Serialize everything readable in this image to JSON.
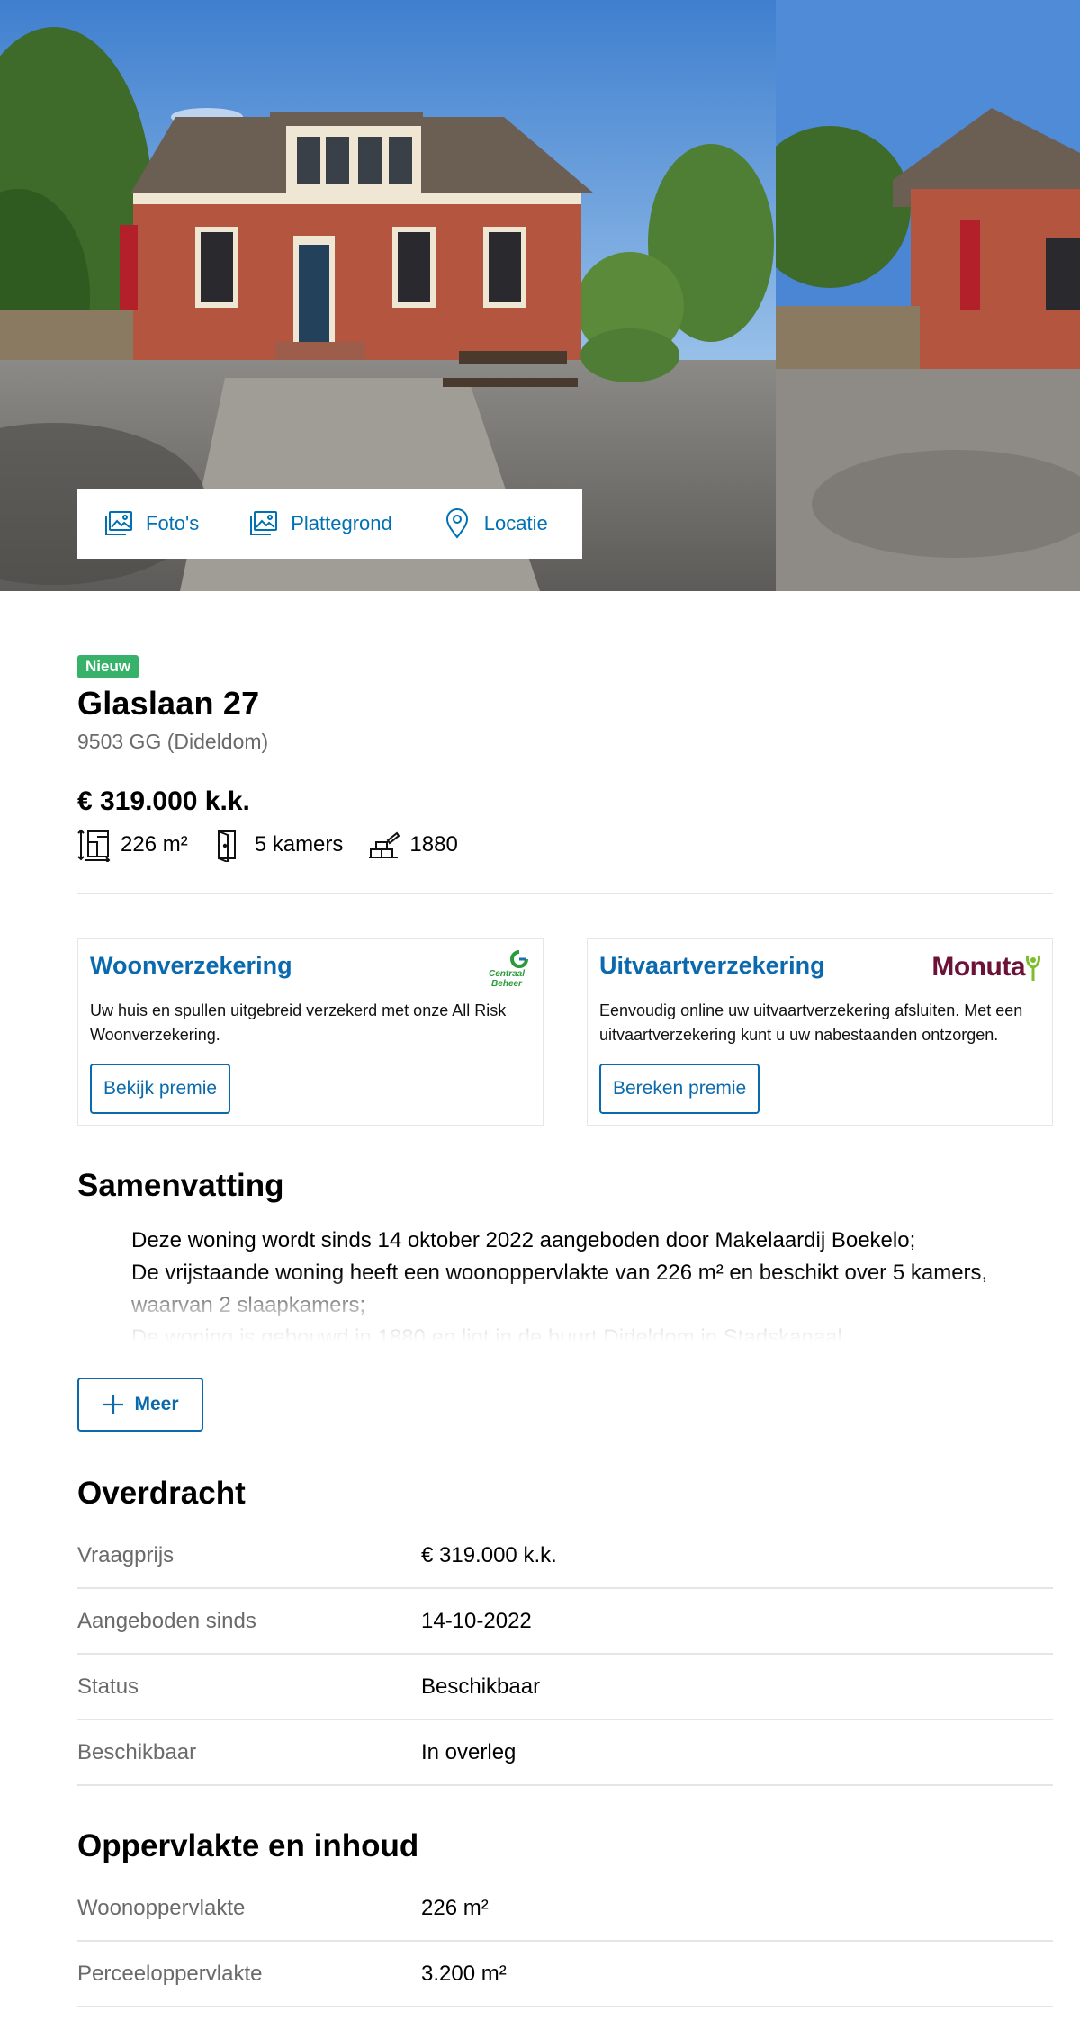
{
  "media": {
    "photos_label": "Foto's",
    "floorplan_label": "Plattegrond",
    "location_label": "Locatie"
  },
  "listing": {
    "badge": "Nieuw",
    "title": "Glaslaan 27",
    "subtitle": "9503 GG (Dideldom)",
    "price": "€ 319.000 k.k.",
    "features": [
      {
        "icon": "floor-area-icon",
        "value": "226 m²"
      },
      {
        "icon": "door-icon",
        "value": "5 kamers"
      },
      {
        "icon": "construction-year-icon",
        "value": "1880"
      }
    ]
  },
  "ads": [
    {
      "title": "Woonverzekering",
      "text": "Uw huis en spullen uitgebreid verzekerd met onze All Risk Woonverzekering.",
      "button": "Bekijk premie",
      "logo": "Centraal Beheer"
    },
    {
      "title": "Uitvaartverzekering",
      "text": "Eenvoudig online uw uitvaartverzekering afsluiten. Met een uitvaartverzekering kunt u uw nabestaanden ontzorgen.",
      "button": "Bereken premie",
      "logo": "Monuta"
    }
  ],
  "summary": {
    "heading": "Samenvatting",
    "items": [
      "Deze woning wordt sinds 14 oktober 2022 aangeboden door Makelaardij Boekelo;",
      "De vrijstaande woning heeft een woonoppervlakte van 226 m² en beschikt over 5 kamers, waarvan 2 slaapkamers;",
      "De woning is gebouwd in 1880 en ligt in de buurt Dideldom in Stadskanaal."
    ],
    "more_button": "Meer"
  },
  "transfer": {
    "heading": "Overdracht",
    "rows": [
      {
        "label": "Vraagprijs",
        "value": "€ 319.000 k.k."
      },
      {
        "label": "Aangeboden sinds",
        "value": "14-10-2022"
      },
      {
        "label": "Status",
        "value": "Beschikbaar"
      },
      {
        "label": "Beschikbaar",
        "value": "In overleg"
      }
    ]
  },
  "area": {
    "heading": "Oppervlakte en inhoud",
    "rows": [
      {
        "label": "Woonoppervlakte",
        "value": "226 m²"
      },
      {
        "label": "Perceeloppervlakte",
        "value": "3.200 m²"
      }
    ]
  },
  "colors": {
    "accent": "#0071b3",
    "badge": "#38b26b",
    "muted_text": "#6a6a6a",
    "divider": "#e5e5e5",
    "monuta": "#6b1236"
  }
}
